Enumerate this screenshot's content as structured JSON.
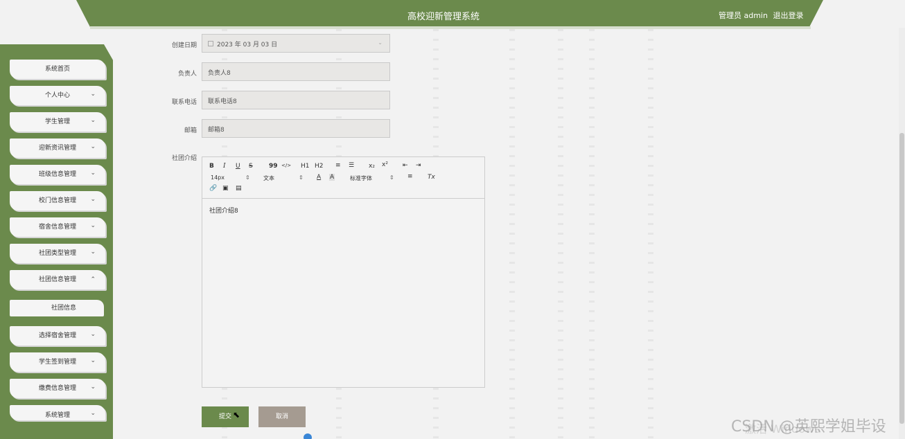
{
  "header": {
    "title": "高校迎新管理系统",
    "user_label": "管理员 admin",
    "logout_label": "退出登录"
  },
  "sidebar": {
    "items": [
      {
        "label": "系统首页",
        "expandable": false
      },
      {
        "label": "个人中心",
        "expandable": true
      },
      {
        "label": "学生管理",
        "expandable": true
      },
      {
        "label": "迎新资讯管理",
        "expandable": true
      },
      {
        "label": "班级信息管理",
        "expandable": true
      },
      {
        "label": "校门信息管理",
        "expandable": true
      },
      {
        "label": "宿舍信息管理",
        "expandable": true
      },
      {
        "label": "社团类型管理",
        "expandable": true
      },
      {
        "label": "社团信息管理",
        "expandable": true,
        "expanded": true
      },
      {
        "label": "选择宿舍管理",
        "expandable": true
      },
      {
        "label": "学生签到管理",
        "expandable": true
      },
      {
        "label": "缴费信息管理",
        "expandable": true
      },
      {
        "label": "系统管理",
        "expandable": true
      }
    ],
    "subitem": "社团信息",
    "chevron_down": "⌄",
    "chevron_up": "⌃"
  },
  "form": {
    "created_label": "创建日期",
    "created_value": "2023 年 03 月 03 日",
    "owner_label": "负责人",
    "owner_value": "负责人8",
    "phone_label": "联系电话",
    "phone_value": "联系电话8",
    "email_label": "邮箱",
    "email_value": "邮箱8",
    "intro_label": "社团介绍",
    "intro_value": "社团介绍8"
  },
  "toolbar": {
    "bold": "B",
    "italic": "I",
    "underline": "U",
    "strike": "S",
    "quote": "99",
    "code": "</>",
    "h1": "H1",
    "h2": "H2",
    "ordered_list": "≡",
    "bullet_list": "☰",
    "subscript": "x₂",
    "superscript": "x²",
    "outdent": "⇤",
    "indent": "⇥",
    "size": "14px",
    "text_type": "文本",
    "font_color": "A",
    "bg_color": "A",
    "font_family": "标准字体",
    "align": "≡",
    "clear": "Tx",
    "link": "🔗",
    "image": "▣",
    "video": "▤",
    "select_arrow": "⇕"
  },
  "buttons": {
    "submit": "提交",
    "cancel": "取消"
  },
  "watermark": "CSDN @英熙学姐毕设",
  "watermark2": "激活 Windows"
}
